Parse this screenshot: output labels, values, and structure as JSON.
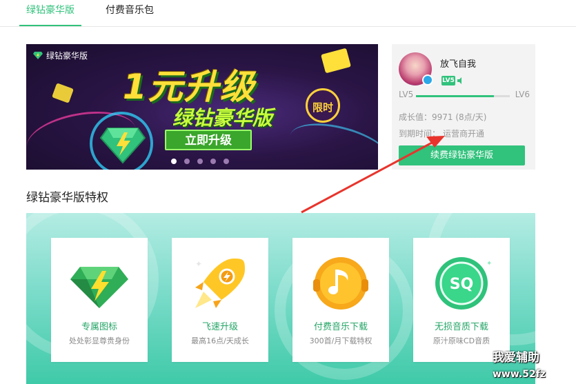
{
  "tabs": [
    {
      "label": "绿钻豪华版",
      "active": true
    },
    {
      "label": "付费音乐包",
      "active": false
    }
  ],
  "banner": {
    "tag": "绿钻豪华版",
    "headline": "1元升级",
    "subline": "绿钻豪华版",
    "badge": "限时",
    "cta": "立即升级",
    "slide_count": 5,
    "active_slide": 1
  },
  "user": {
    "name": "放飞自我",
    "level_badge": "LV5",
    "level_current": "LV5",
    "level_next": "LV6",
    "level_progress": 0.83,
    "growth": "成长值：9971 (8点/天)",
    "expire_label": "到期时间：",
    "expire_value": "运营商开通",
    "renew_button": "续费绿钻豪华版"
  },
  "section": {
    "title": "绿钻豪华版特权"
  },
  "features": [
    {
      "icon": "green-diamond-icon",
      "title": "专属图标",
      "subtitle": "处处彰显尊贵身份"
    },
    {
      "icon": "rocket-icon",
      "title": "飞速升级",
      "subtitle": "最高16点/天成长"
    },
    {
      "icon": "music-note-icon",
      "title": "付费音乐下载",
      "subtitle": "300首/月下载特权"
    },
    {
      "icon": "sq-lossless-icon",
      "title": "无损音质下载",
      "subtitle": "原汁原味CD音质"
    }
  ],
  "watermark": {
    "line1": "我爱辅助",
    "line2": "www.52fz"
  },
  "colors": {
    "accent": "#31c27c",
    "banner_bg": "#2a1546",
    "feature_bg": "#7ddccb",
    "arrow": "#e8342c"
  }
}
